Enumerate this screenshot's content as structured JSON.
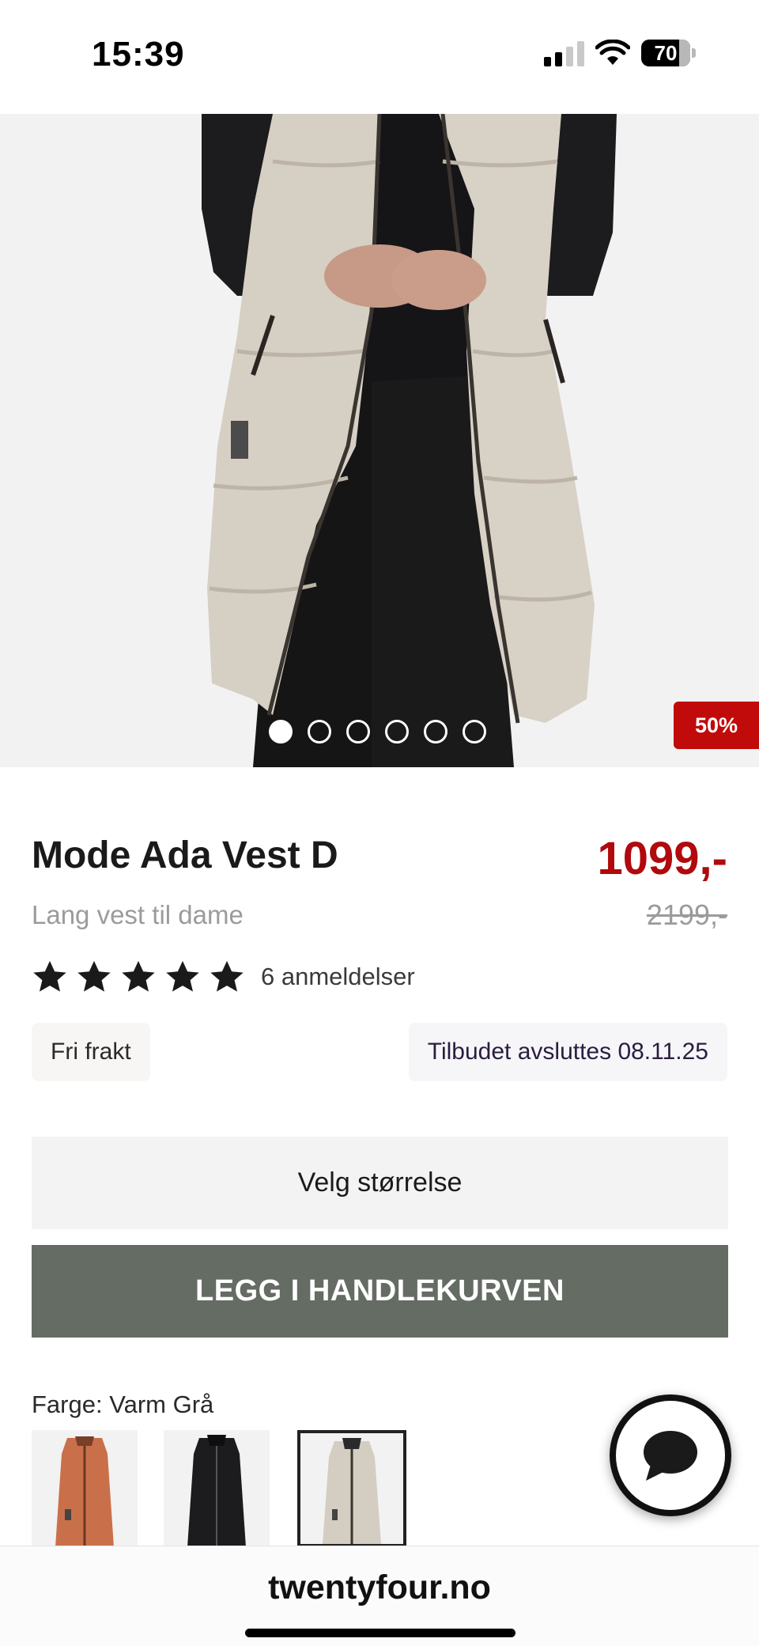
{
  "status_bar": {
    "time": "15:39",
    "battery_level": "70",
    "icons": [
      "signal-icon",
      "wifi-icon",
      "battery-icon"
    ]
  },
  "gallery": {
    "image_count": 6,
    "active_index": 0,
    "discount_badge": "50%"
  },
  "product": {
    "title": "Mode Ada Vest D",
    "subtitle": "Lang vest til dame",
    "price_now": "1099,-",
    "price_old": "2199,-",
    "rating_stars": 5,
    "review_count": "6 anmeldelser",
    "shipping_chip": "Fri frakt",
    "offer_chip": "Tilbudet avsluttes 08.11.25"
  },
  "actions": {
    "size_select_label": "Velg størrelse",
    "add_to_cart_label": "LEGG I HANDLEKURVEN"
  },
  "colors": {
    "label": "Farge: Varm Grå",
    "swatches": [
      "orange",
      "black",
      "warm-grey"
    ],
    "selected_index": 2
  },
  "browser": {
    "url": "twentyfour.no"
  },
  "theme": {
    "price_red": "#b0090e",
    "badge_red": "#c10a0a",
    "cart_button": "#646c64",
    "size_button": "#f3f3f3"
  }
}
